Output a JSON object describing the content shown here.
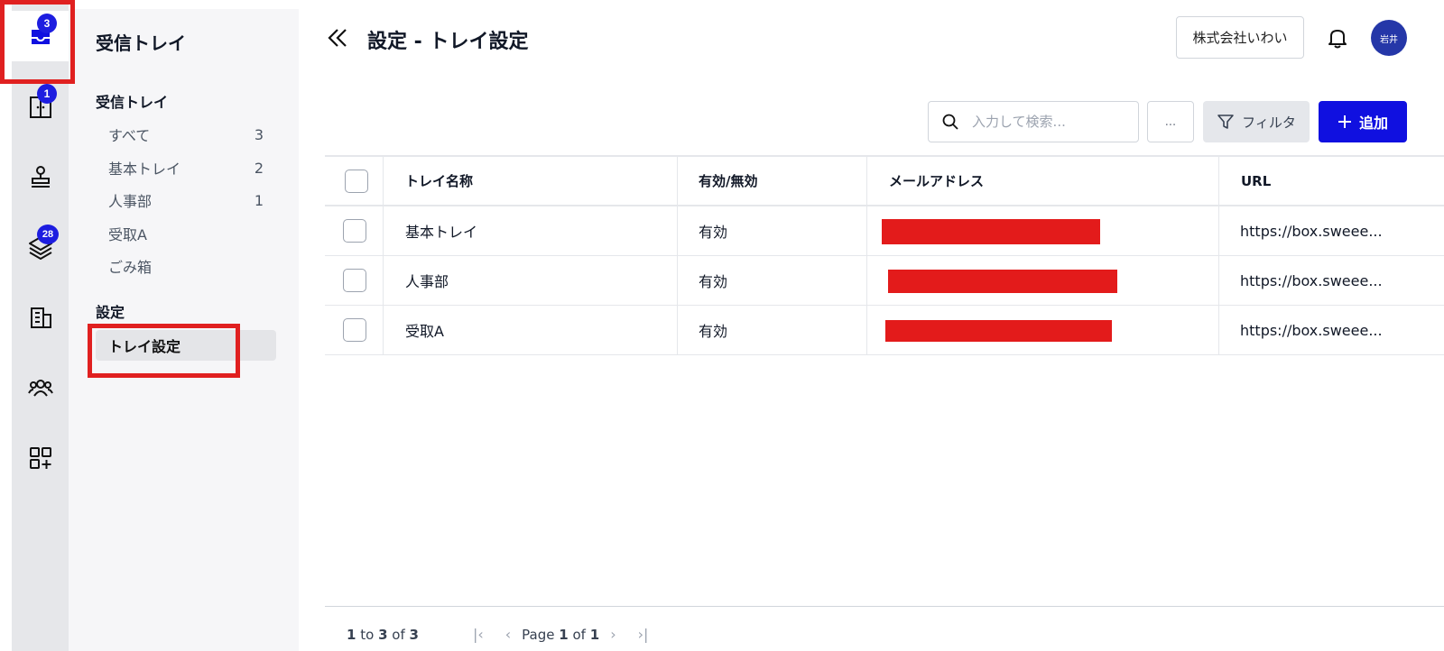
{
  "rail": {
    "items": [
      {
        "name": "inbox",
        "badge": "3"
      },
      {
        "name": "cabinet",
        "badge": "1"
      },
      {
        "name": "stamp",
        "badge": ""
      },
      {
        "name": "layers",
        "badge": "28"
      },
      {
        "name": "building",
        "badge": ""
      },
      {
        "name": "users",
        "badge": ""
      },
      {
        "name": "apps-add",
        "badge": ""
      }
    ]
  },
  "sidebar": {
    "title": "受信トレイ",
    "inbox_section": "受信トレイ",
    "items": [
      {
        "label": "すべて",
        "count": "3"
      },
      {
        "label": "基本トレイ",
        "count": "2"
      },
      {
        "label": "人事部",
        "count": "1"
      },
      {
        "label": "受取A",
        "count": ""
      },
      {
        "label": "ごみ箱",
        "count": ""
      }
    ],
    "settings_section": "設定",
    "settings_items": [
      {
        "label": "トレイ設定"
      }
    ]
  },
  "header": {
    "title": "設定 - トレイ設定",
    "company": "株式会社いわい",
    "avatar_text": "岩井"
  },
  "toolbar": {
    "search_placeholder": "入力して検索...",
    "more_label": "...",
    "filter_label": "フィルタ",
    "add_label": "追加"
  },
  "table": {
    "columns": [
      "トレイ名称",
      "有効/無効",
      "メールアドレス",
      "URL"
    ],
    "rows": [
      {
        "name": "基本トレイ",
        "status": "有効",
        "url": "https://box.sweee..."
      },
      {
        "name": "人事部",
        "status": "有効",
        "url": "https://box.sweee..."
      },
      {
        "name": "受取A",
        "status": "有効",
        "url": "https://box.sweee..."
      }
    ]
  },
  "pagination": {
    "from": "1",
    "to_word": "to",
    "to": "3",
    "of_word": "of",
    "total": "3",
    "page_word": "Page",
    "page": "1",
    "pages_of": "of",
    "pages": "1"
  },
  "colors": {
    "accent": "#1010e0",
    "badge": "#1d1de0",
    "highlight": "#e02020",
    "redaction": "#e31b1b"
  }
}
